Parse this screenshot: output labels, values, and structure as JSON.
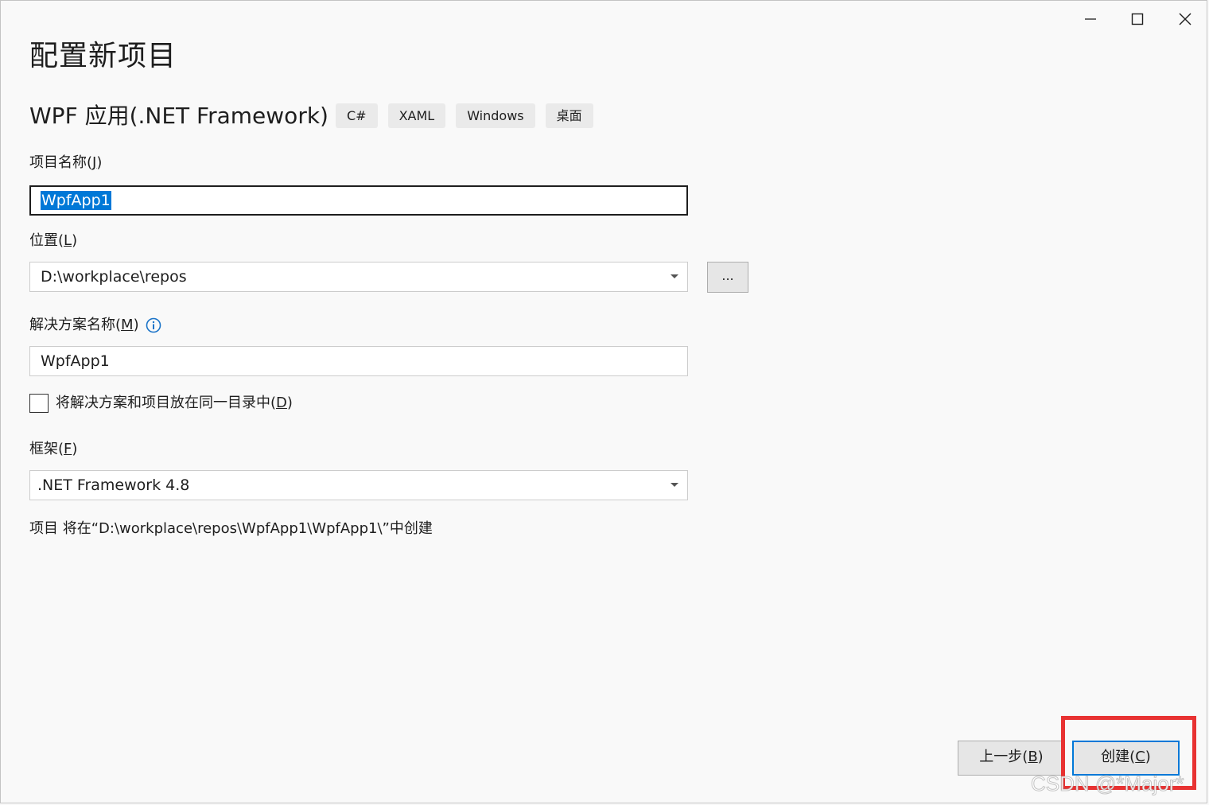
{
  "window": {
    "minimize_icon": "minimize-icon",
    "maximize_icon": "maximize-icon",
    "close_icon": "close-icon"
  },
  "page_title": "配置新项目",
  "template": {
    "name": "WPF 应用(.NET Framework)",
    "tags": [
      "C#",
      "XAML",
      "Windows",
      "桌面"
    ]
  },
  "project_name": {
    "label": "项目名称(",
    "label_key": "J",
    "label_end": ")",
    "value": "WpfApp1"
  },
  "location": {
    "label": "位置(",
    "label_key": "L",
    "label_end": ")",
    "value": "D:\\workplace\\repos",
    "browse_label": "..."
  },
  "solution_name": {
    "label": "解决方案名称(",
    "label_key": "M",
    "label_end": ")",
    "value": "WpfApp1",
    "info_icon": "info-icon"
  },
  "same_directory": {
    "label": "将解决方案和项目放在同一目录中(",
    "label_key": "D",
    "label_end": ")",
    "checked": false
  },
  "framework": {
    "label": "框架(",
    "label_key": "F",
    "label_end": ")",
    "value": ".NET Framework 4.8"
  },
  "path_info": "项目 将在“D:\\workplace\\repos\\WpfApp1\\WpfApp1\\”中创建",
  "footer": {
    "back": {
      "label": "上一步(",
      "key": "B",
      "end": ")"
    },
    "create": {
      "label": "创建(",
      "key": "C",
      "end": ")"
    }
  },
  "watermark": "CSDN @*Major*",
  "colors": {
    "accent": "#0078d7",
    "highlight_box": "#e83232",
    "background": "#f9f9f9"
  }
}
